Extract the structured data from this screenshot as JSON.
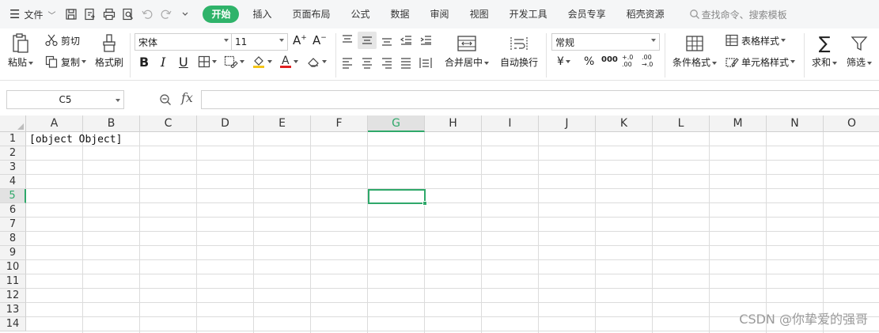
{
  "menubar": {
    "file_label": "文件",
    "tabs": [
      "开始",
      "插入",
      "页面布局",
      "公式",
      "数据",
      "审阅",
      "视图",
      "开发工具",
      "会员专享",
      "稻壳资源"
    ],
    "active_tab": "开始",
    "search_placeholder": "查找命令、搜索模板",
    "accent_color": "#2fb36a"
  },
  "ribbon": {
    "paste": "粘贴",
    "cut": "剪切",
    "copy": "复制",
    "format_painter": "格式刷",
    "font_name": "宋体",
    "font_size": "11",
    "bold": "B",
    "italic": "I",
    "underline": "U",
    "merge_center": "合并居中",
    "wrap_text": "自动换行",
    "number_format": "常规",
    "currency": "¥",
    "percent": "%",
    "thousands": "000",
    "dec_inc": "+.0 .00",
    "dec_dec": ".00 →.0",
    "conditional_format": "条件格式",
    "table_style": "表格样式",
    "cell_style": "单元格样式",
    "sum": "求和",
    "filter": "筛选"
  },
  "formula_bar": {
    "cell_ref": "C5",
    "fx": "fx",
    "content": ""
  },
  "grid": {
    "columns": [
      "A",
      "B",
      "C",
      "D",
      "E",
      "F",
      "G",
      "H",
      "I",
      "J",
      "K",
      "L",
      "M",
      "N",
      "O"
    ],
    "rows": [
      "1",
      "2",
      "3",
      "4",
      "5",
      "6",
      "7",
      "8",
      "9",
      "10",
      "11",
      "12",
      "13",
      "14"
    ],
    "selected_column": "G",
    "selected_row": "5",
    "cell_A1": "[object Object]"
  },
  "watermark": "CSDN @你挚爱的强哥"
}
